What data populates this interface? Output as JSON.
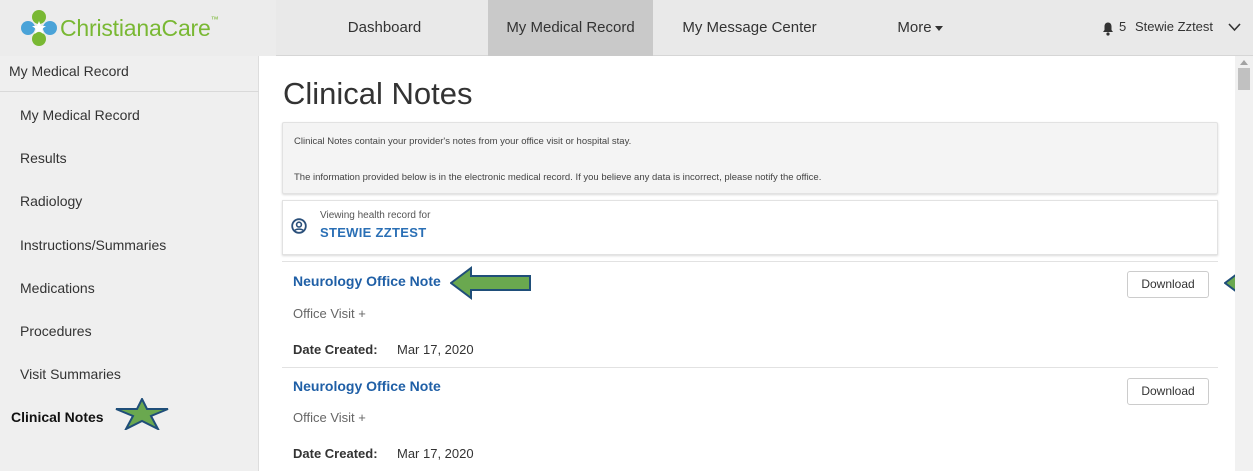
{
  "brand": {
    "name": "ChristianaCare",
    "trademark": "™"
  },
  "nav": {
    "dashboard": "Dashboard",
    "medical_record": "My Medical Record",
    "message_center": "My Message Center",
    "more": "More"
  },
  "header": {
    "notification_count": "5",
    "user_name": "Stewie Zztest"
  },
  "sidebar": {
    "title": "My Medical Record",
    "items": [
      {
        "label": "My Medical Record"
      },
      {
        "label": "Results"
      },
      {
        "label": "Radiology"
      },
      {
        "label": "Instructions/Summaries"
      },
      {
        "label": "Medications"
      },
      {
        "label": "Procedures"
      },
      {
        "label": "Visit Summaries"
      },
      {
        "label": "Clinical Notes"
      }
    ],
    "active": "Clinical Notes"
  },
  "main": {
    "title": "Clinical Notes",
    "info_lines": [
      "Clinical Notes contain your provider's notes from your office visit or hospital stay.",
      "The information provided below is in the electronic medical record. If you believe any data is incorrect, please notify the office."
    ],
    "record": {
      "viewing_label": "Viewing health record for",
      "patient_name": "STEWIE ZZTEST"
    },
    "notes": [
      {
        "title": "Neurology Office Note",
        "subtitle": "Office Visit +",
        "date_label": "Date Created:",
        "date_value": "Mar 17, 2020",
        "download_label": "Download"
      },
      {
        "title": "Neurology Office Note",
        "subtitle": "Office Visit +",
        "date_label": "Date Created:",
        "date_value": "Mar 17, 2020",
        "download_label": "Download"
      }
    ]
  },
  "colors": {
    "brand_green": "#79b833",
    "link_blue": "#1f5fa6",
    "annotation_green": "#6aa84f",
    "annotation_navy": "#1f4e79"
  }
}
